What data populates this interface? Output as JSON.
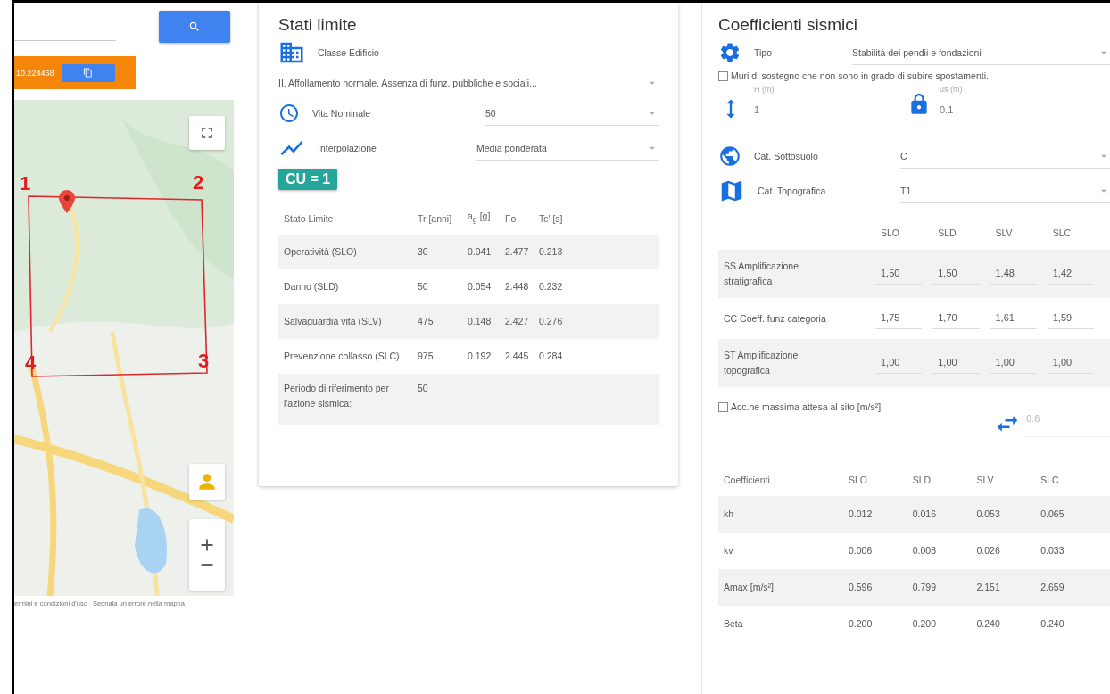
{
  "coordinates": {
    "text": "10.224468"
  },
  "map": {
    "corners": [
      "1",
      "2",
      "4",
      "3"
    ],
    "attribution": [
      "ermini e condizioni d'uso",
      "Segnala un errore nella mappa"
    ]
  },
  "stati_limite": {
    "title": "Stati limite",
    "classe_edificio": {
      "label": "Classe Edificio",
      "value": "II. Affollamento normale. Assenza di funz. pubbliche e sociali..."
    },
    "vita_nominale": {
      "label": "Vita Nominale",
      "value": "50"
    },
    "interpolazione": {
      "label": "Interpolazione",
      "value": "Media ponderata"
    },
    "cu_badge": "CU = 1",
    "table": {
      "columns": [
        "Stato Limite",
        "Tr [anni]",
        "a$_{g}$ [g]",
        "Fo",
        "Tc' [s]"
      ],
      "rows": [
        [
          "Operatività (SLO)",
          "30",
          "0.041",
          "2.477",
          "0.213"
        ],
        [
          "Danno (SLD)",
          "50",
          "0.054",
          "2.448",
          "0.232"
        ],
        [
          "Salvaguardia vita (SLV)",
          "475",
          "0.148",
          "2.427",
          "0.276"
        ],
        [
          "Prevenzione collasso (SLC)",
          "975",
          "0.192",
          "2.445",
          "0.284"
        ],
        [
          "Periodo di riferimento per l'azione sismica:",
          "50",
          "",
          "",
          ""
        ]
      ]
    }
  },
  "coefficienti": {
    "title": "Coefficienti sismici",
    "tipo": {
      "label": "Tipo",
      "value": "Stabilità dei pendii e fondazioni"
    },
    "muri": {
      "label": "Muri di sostegno che non sono in grado di subire spostamenti.",
      "checked": false
    },
    "h": {
      "label": "H (m)",
      "value": "1"
    },
    "us": {
      "label": "us (m)",
      "value": "0.1"
    },
    "sottosuolo": {
      "label": "Cat. Sottosuolo",
      "value": "C"
    },
    "topografica": {
      "label": "Cat. Topografica",
      "value": "T1"
    },
    "amp_table": {
      "columns": [
        "SLO",
        "SLD",
        "SLV",
        "SLC"
      ],
      "rows": [
        {
          "label": "SS Amplificazione stratigrafica",
          "values": [
            "1,50",
            "1,50",
            "1,48",
            "1,42"
          ]
        },
        {
          "label": "CC Coeff. funz categoria",
          "values": [
            "1,75",
            "1,70",
            "1,61",
            "1,59"
          ]
        },
        {
          "label": "ST Amplificazione topografica",
          "values": [
            "1,00",
            "1,00",
            "1,00",
            "1,00"
          ]
        }
      ]
    },
    "acc": {
      "label": "Acc.ne massima attesa al sito [m/s²]",
      "checked": false,
      "value": "0.6"
    },
    "coef_table": {
      "columns": [
        "Coefficienti",
        "SLO",
        "SLD",
        "SLV",
        "SLC"
      ],
      "rows": [
        [
          "kh",
          "0.012",
          "0.016",
          "0.053",
          "0.065"
        ],
        [
          "kv",
          "0.006",
          "0.008",
          "0.026",
          "0.033"
        ],
        [
          "Amax [m/s²]",
          "0.596",
          "0.799",
          "2.151",
          "2.659"
        ],
        [
          "Beta",
          "0.200",
          "0.200",
          "0.240",
          "0.240"
        ]
      ]
    }
  }
}
